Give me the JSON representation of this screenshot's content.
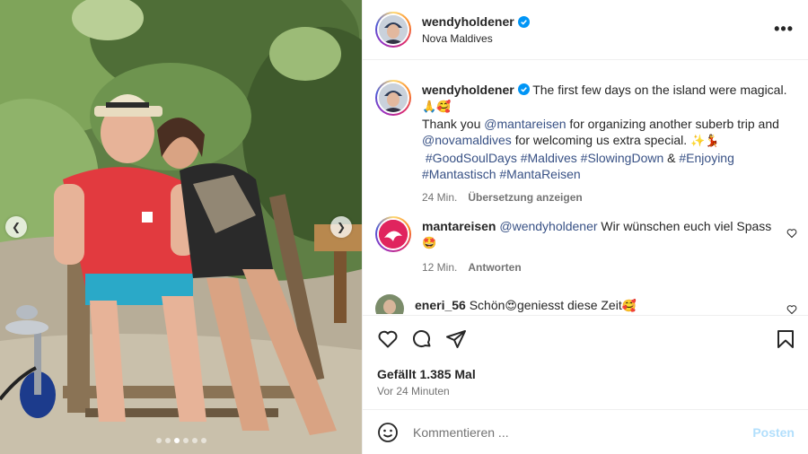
{
  "post": {
    "username": "wendyholdener",
    "location": "Nova Maldives",
    "more_label": "•••",
    "verified": true,
    "carousel": {
      "total_slides": 6,
      "active_slide": 3
    }
  },
  "caption": {
    "username": "wendyholdener",
    "line1": "The first few days on the island were magical.",
    "line1_emoji": "🙏🥰",
    "thanks_prefix": "Thank you ",
    "mention1": "@mantareisen",
    "thanks_mid": " for organizing another suberb trip and",
    "mention2": "@novamaldives",
    "thanks_end": " for welcoming us extra special. ",
    "thanks_emoji": "✨💃",
    "tag1": "#GoodSoulDays",
    "tag2": "#Maldives",
    "tag3": "#SlowingDown",
    "amp": " & ",
    "tag4": "#Enjoying",
    "tag5": "#Mantastisch",
    "tag6": "#MantaReisen",
    "time": "24 Min.",
    "translate": "Übersetzung anzeigen"
  },
  "comments": [
    {
      "username": "mantareisen",
      "mention": "@wendyholdener",
      "text": " Wir wünschen euch viel Spass",
      "emoji": "🤩",
      "time": "12 Min.",
      "reply": "Antworten"
    },
    {
      "username": "eneri_56",
      "text_a": " Schön",
      "emoji_a": "😍",
      "text_b": "geniesst diese Zeit",
      "emoji_b": "🥰"
    }
  ],
  "actions": {
    "likes": "Gefällt 1.385 Mal",
    "posted": "Vor 24 Minuten"
  },
  "comment_box": {
    "placeholder": "Kommentieren ...",
    "post_label": "Posten"
  },
  "colors": {
    "link": "#385185",
    "verified": "#0095f6",
    "post_disabled": "#b2dffc"
  }
}
